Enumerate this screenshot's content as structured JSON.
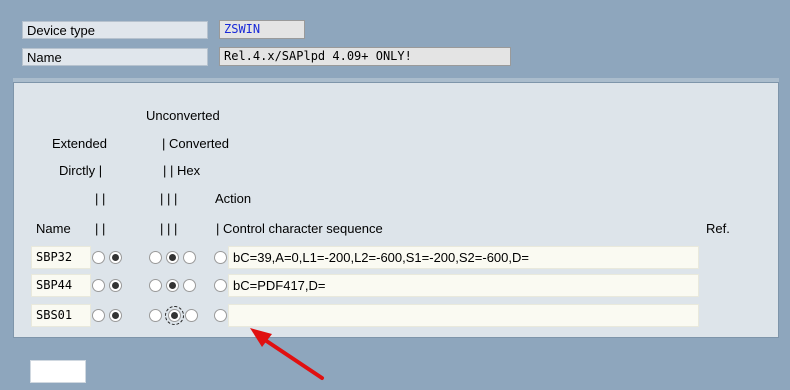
{
  "header": {
    "device_type_label": "Device type",
    "device_type_value": "ZSWIN",
    "name_label": "Name",
    "name_value": "Rel.4.x/SAPlpd 4.09+ ONLY!"
  },
  "column_headers": {
    "unconverted": "Unconverted",
    "extended": "Extended",
    "converted": "| Converted",
    "dirctly": "Dirctly |",
    "hex": "| | Hex",
    "pipes_a": "| |",
    "pipes_b": "| | |",
    "action": "Action",
    "name": "Name",
    "name_pipes": "| |",
    "pipes_c": "| | |",
    "control_seq": "| Control character sequence",
    "ref": "Ref."
  },
  "rows": [
    {
      "name": "SBP32",
      "sequence": "bC=39,A=0,L1=-200,L2=-600,S1=-200,S2=-600,D=",
      "extended": false,
      "directly": true,
      "unconverted": false,
      "converted": true,
      "hex": false,
      "action": false
    },
    {
      "name": "SBP44",
      "sequence": "bC=PDF417,D=",
      "extended": false,
      "directly": true,
      "unconverted": false,
      "converted": true,
      "hex": false,
      "action": false
    },
    {
      "name": "SBS01",
      "sequence": "",
      "extended": false,
      "directly": true,
      "unconverted": false,
      "converted": true,
      "hex": false,
      "action": false
    }
  ],
  "colors": {
    "background": "#8ea6bd",
    "panel": "#dde4ea",
    "arrow": "#e01010",
    "device_type_text": "#1a2ad8"
  },
  "icons": [
    "red-arrow-pointer-icon"
  ]
}
